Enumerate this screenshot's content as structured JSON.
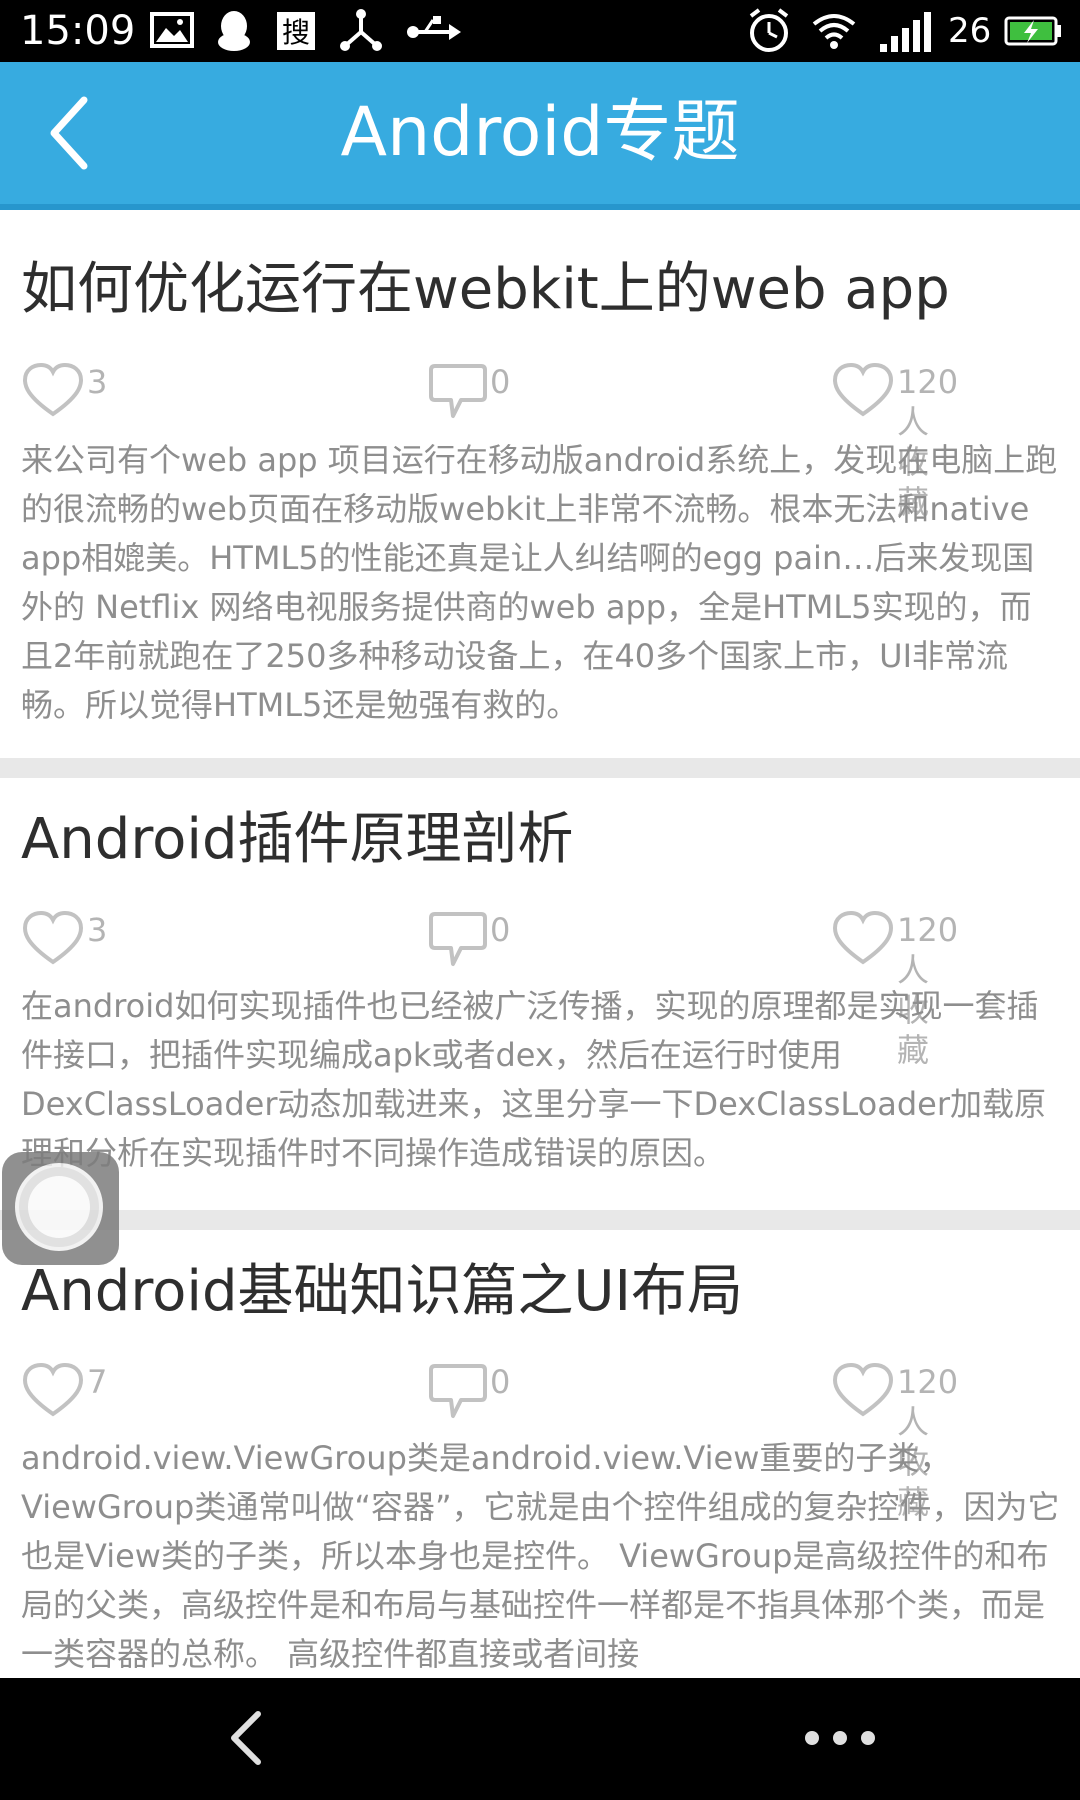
{
  "status_bar": {
    "time": "15:09",
    "signal_number": "26",
    "icons": [
      "image-icon",
      "qq-icon",
      "sogou-icon",
      "share-network-icon",
      "usb-icon",
      "alarm-icon",
      "wifi-icon",
      "signal-icon",
      "battery-charging-icon"
    ]
  },
  "app_bar": {
    "title": "Android专题",
    "back_icon": "back-arrow-icon"
  },
  "articles": [
    {
      "title": "如何优化运行在webkit上的web app",
      "likes": "3",
      "comments": "0",
      "favorites": "120人收藏",
      "body": "来公司有个web app 项目运行在移动版android系统上，发现在电脑上跑的很流畅的web页面在移动版webkit上非常不流畅。根本无法和native app相媲美。HTML5的性能还真是让人纠结啊的egg pain…后来发现国外的 Netflix 网络电视服务提供商的web app，全是HTML5实现的，而且2年前就跑在了250多种移动设备上，在40多个国家上市，UI非常流畅。所以觉得HTML5还是勉强有救的。"
    },
    {
      "title": "Android插件原理剖析",
      "likes": "3",
      "comments": "0",
      "favorites": "120人收藏",
      "body": "在android如何实现插件也已经被广泛传播，实现的原理都是实现一套插件接口，把插件实现编成apk或者dex，然后在运行时使用DexClassLoader动态加载进来，这里分享一下DexClassLoader加载原理和分析在实现插件时不同操作造成错误的原因。"
    },
    {
      "title": "Android基础知识篇之UI布局",
      "likes": "7",
      "comments": "0",
      "favorites": "120人收藏",
      "body": "android.view.ViewGroup类是android.view.View重要的子类，ViewGroup类通常叫做“容器”，它就是由个控件组成的复杂控件，因为它也是View类的子类，所以本身也是控件。 ViewGroup是高级控件的和布局的父类，高级控件是和布局与基础控件一样都是不指具体那个类，而是一类容器的总称。 高级控件都直接或者间接"
    }
  ],
  "nav_bar": {
    "back_icon": "nav-back-icon",
    "more_icon": "more-dots-icon"
  },
  "colors": {
    "app_bar": "#37abe0",
    "title_text": "#2e2e2e",
    "body_text": "#8e8e8e",
    "meta_text": "#b4b4b4",
    "divider": "#e8e8e8"
  }
}
